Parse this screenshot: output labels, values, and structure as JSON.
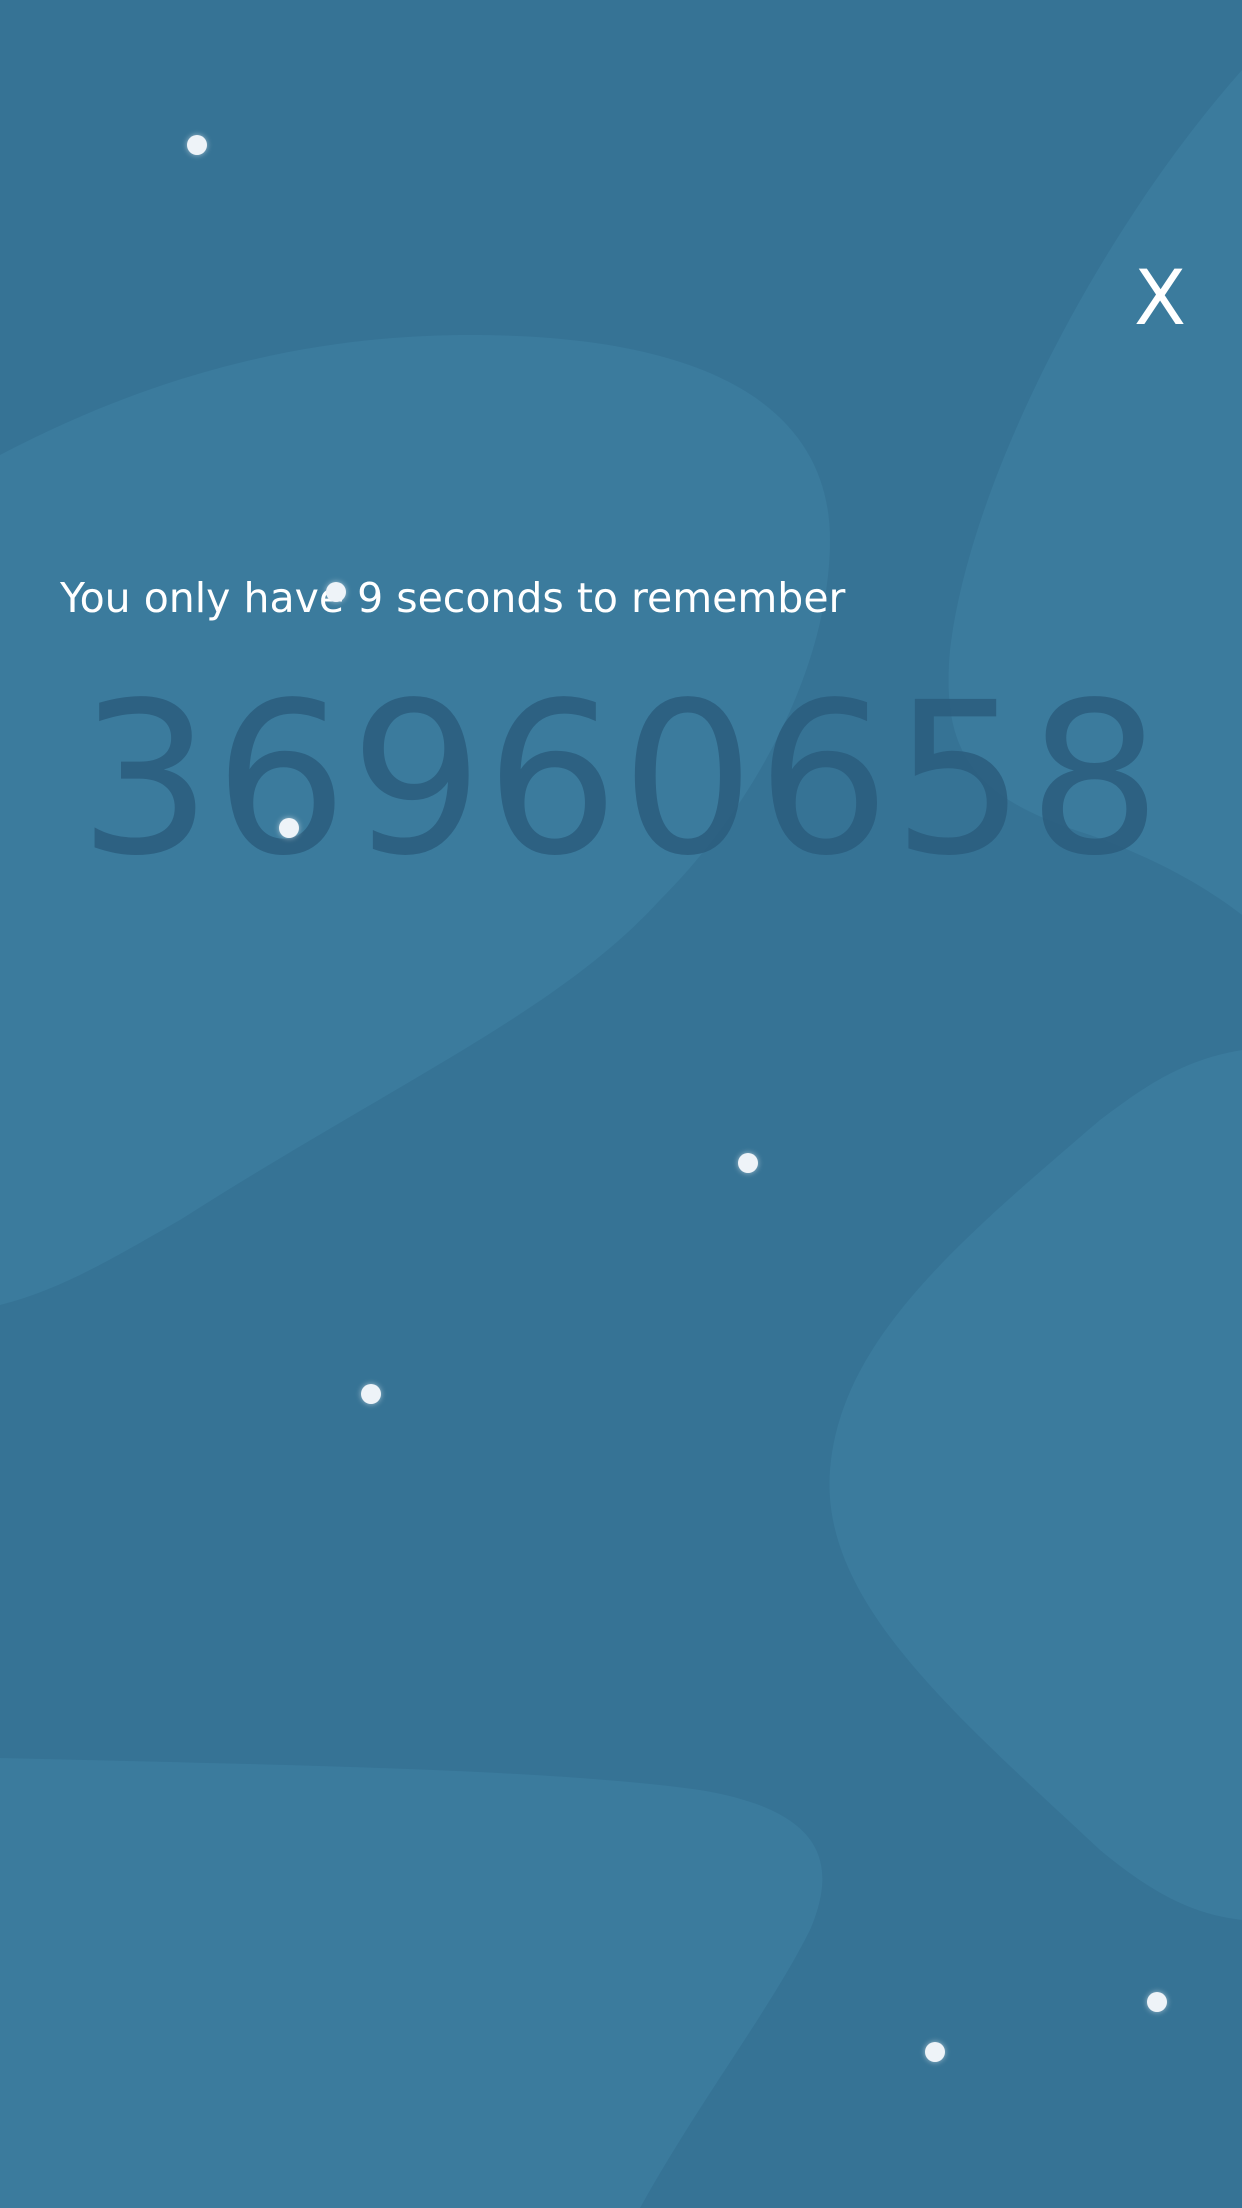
{
  "header": {
    "close_label": "X"
  },
  "game": {
    "instruction": "You only have 9 seconds to remember",
    "number": "36960658"
  },
  "colors": {
    "background": "#367395",
    "blob": "#3b7b9d",
    "number": "#2b5d7e",
    "text": "#ffffff",
    "dot": "#eef3f8"
  }
}
